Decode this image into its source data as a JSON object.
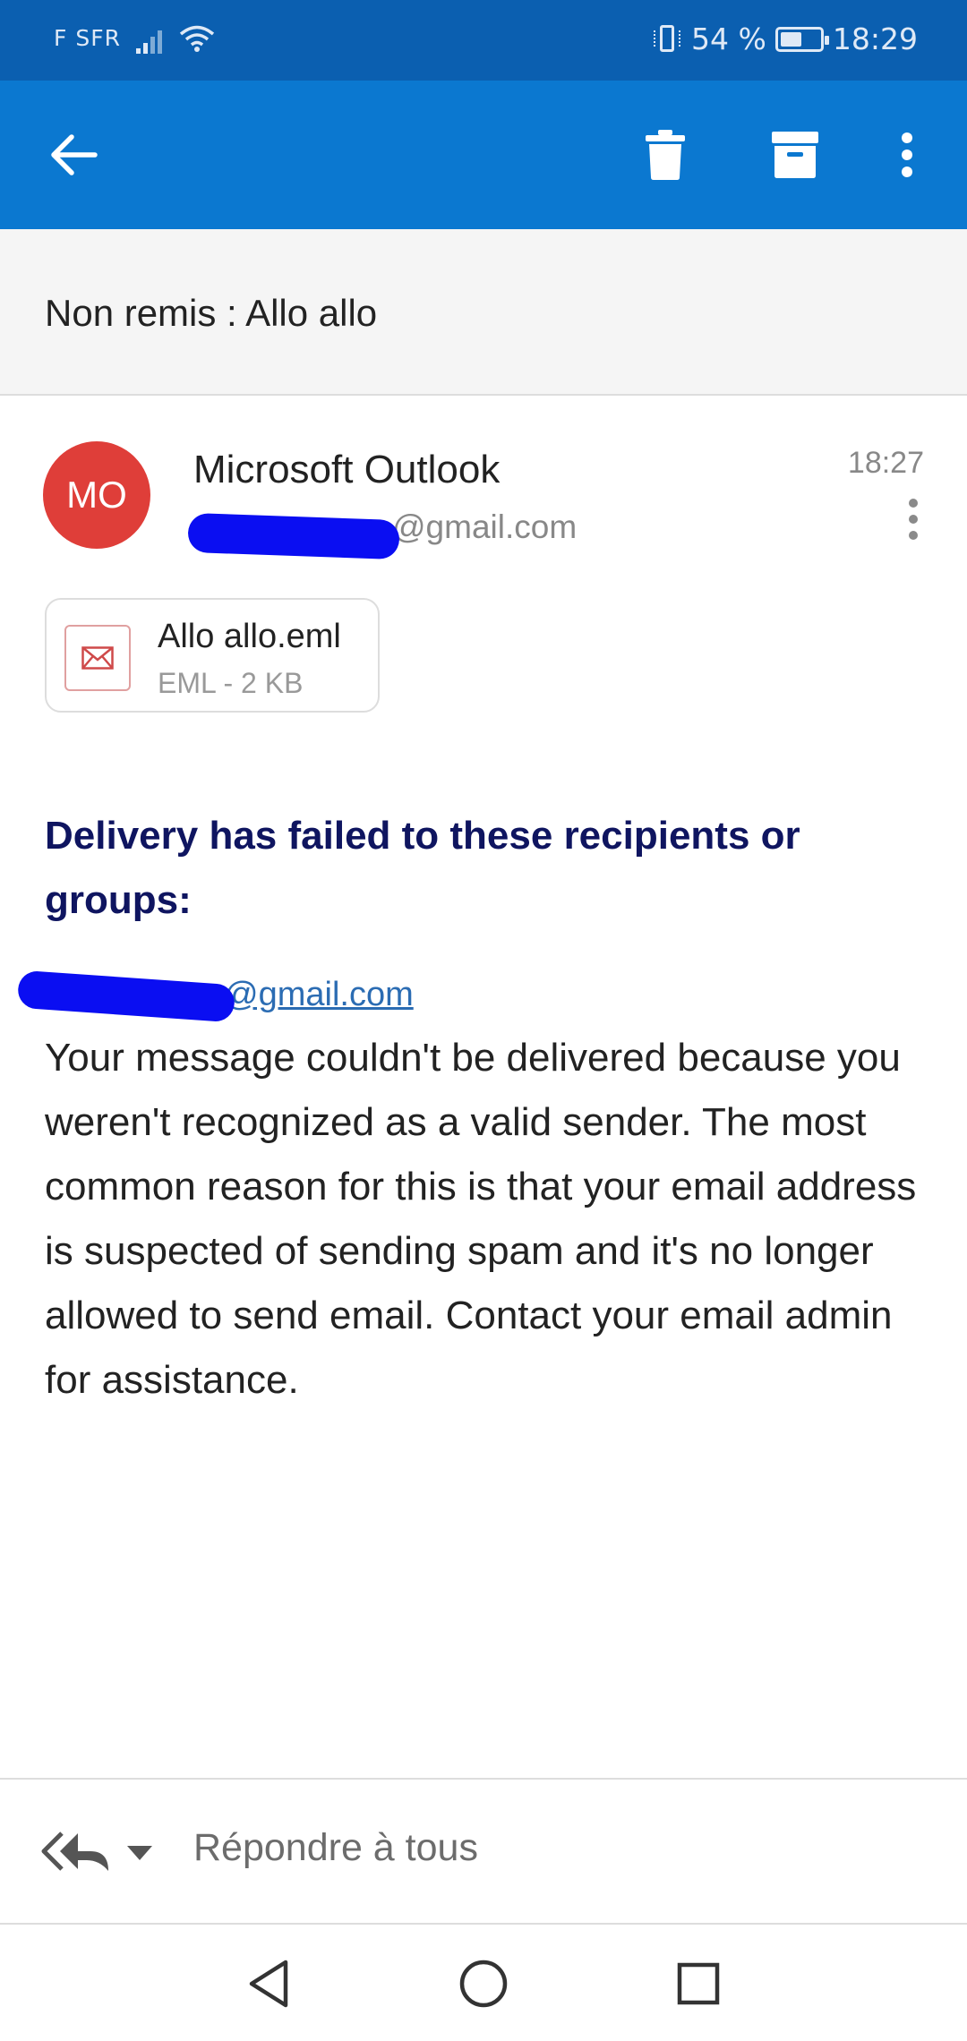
{
  "status_bar": {
    "carrier": "F SFR",
    "battery_percent": "54 %",
    "battery_level": 0.54,
    "time": "18:29"
  },
  "colors": {
    "status_bar": "#0b5fb0",
    "app_bar": "#0b78d0",
    "avatar": "#df3e39",
    "heading": "#0f1560",
    "link": "#2b6cb3",
    "redaction": "#0a0ef2"
  },
  "toolbar": {
    "icons": [
      "arrow-left-icon",
      "trash-icon",
      "archive-icon",
      "more-vertical-icon"
    ]
  },
  "message": {
    "subject": "Non remis : Allo allo",
    "sender": {
      "initials": "MO",
      "name": "Microsoft Outlook",
      "email_visible": "@gmail.com"
    },
    "time": "18:27",
    "attachment": {
      "name": "Allo allo.eml",
      "meta": "EML - 2 KB",
      "icon": "envelope-icon"
    },
    "failure_heading": "Delivery has failed to these recipients or groups:",
    "recipient_visible": "@gmail.com",
    "body": "Your message couldn't be delivered because you weren't recognized as a valid sender. The most common reason for this is that your email address is suspected of sending spam and it's no longer allowed to send email. Contact your email admin for assistance."
  },
  "reply_bar": {
    "label": "Répondre à tous",
    "icon": "reply-all-icon"
  },
  "nav_bar": {
    "icons": [
      "nav-back-icon",
      "nav-home-icon",
      "nav-recent-icon"
    ]
  }
}
